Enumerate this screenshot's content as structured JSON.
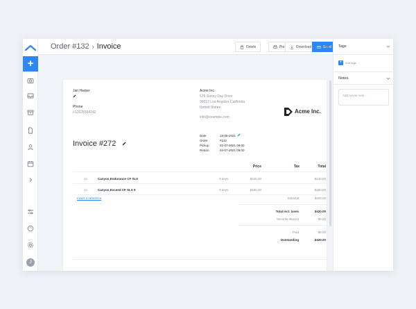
{
  "header": {
    "order": "Order #132",
    "page": "Invoice",
    "buttons": {
      "delete": "Delete",
      "print": "Print",
      "download": "Download",
      "send": "Send"
    }
  },
  "colors": {
    "accent": "#2f86f6",
    "text": "#2b2f36",
    "muted": "#8a919b"
  },
  "rail": {
    "icons": [
      "logo-icon",
      "add-icon",
      "camera-icon",
      "inbox-icon",
      "archive-icon",
      "document-icon",
      "user-icon",
      "calendar-icon",
      "chevron-right-icon",
      "settings-sliders-icon",
      "help-icon",
      "gear-icon",
      "avatar"
    ]
  },
  "invoice": {
    "customer": {
      "name": "Jan Harper",
      "phone_label": "Phone",
      "phone": "+12025554242"
    },
    "company": {
      "name": "Acme Inc.",
      "address1": "575 Sunny Day Drive",
      "address2": "90017 Los Angeles California",
      "country": "United States",
      "email": "info@example.com",
      "logo_text": "Acme Inc."
    },
    "title": "Invoice #272",
    "meta": [
      {
        "label": "Date",
        "value": "18-08-2021"
      },
      {
        "label": "Order",
        "value": "#132"
      },
      {
        "label": "Pickup",
        "value": "02-07-2021 09:00"
      },
      {
        "label": "Return",
        "value": "04-07-2021 09:00"
      }
    ],
    "columns": {
      "price": "Price",
      "tax": "Tax",
      "total": "Total"
    },
    "lines": [
      {
        "qty": "1x",
        "name": "Canyon Endurance CF SLX",
        "days": "3 days",
        "price": "$240.00",
        "total": "$240.00"
      },
      {
        "qty": "1x",
        "name": "Canyon Exceed CF SLX 9",
        "days": "3 days",
        "price": "$180.00",
        "total": "$180.00"
      }
    ],
    "insert_reference": "Insert a reference",
    "summary": [
      {
        "label": "Subtotal",
        "value": "$420.00",
        "bold": false
      },
      {
        "label": "Total incl. taxes",
        "value": "$420.00",
        "bold": true
      },
      {
        "label": "Security deposit",
        "value": "$0.00",
        "bold": false
      },
      {
        "label": "Paid",
        "value": "$0.00",
        "bold": false
      },
      {
        "label": "Outstanding",
        "value": "$420.00",
        "bold": true
      }
    ]
  },
  "panel": {
    "tags_title": "Tags",
    "add_tags": "Add tags",
    "notes_title": "Notes",
    "note_placeholder": "Add a new note..."
  }
}
